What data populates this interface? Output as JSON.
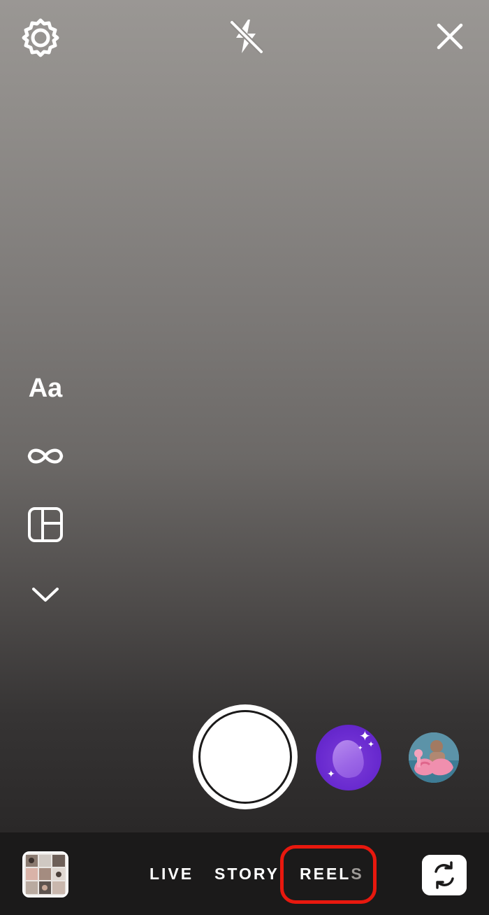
{
  "top_bar": {
    "settings_icon": "gear-icon",
    "flash_icon": "flash-off-icon",
    "close_icon": "close-icon"
  },
  "left_tools": {
    "create_label": "Aa",
    "boomerang_icon": "infinity-icon",
    "layout_icon": "layout-grid-icon",
    "more_icon": "chevron-down-icon"
  },
  "capture": {
    "shutter": "shutter-button",
    "effects": [
      "purple-orb-effect",
      "photo-effect"
    ]
  },
  "modes": {
    "live": "LIVE",
    "story": "STORY",
    "reels": "REELS",
    "selected": "STORY"
  },
  "bottom": {
    "gallery_icon": "gallery-thumbnail",
    "flip_icon": "flip-camera-icon"
  },
  "colors": {
    "highlight": "#e8180e",
    "effect_purple": "#6a2bd0",
    "text": "#ffffff"
  }
}
